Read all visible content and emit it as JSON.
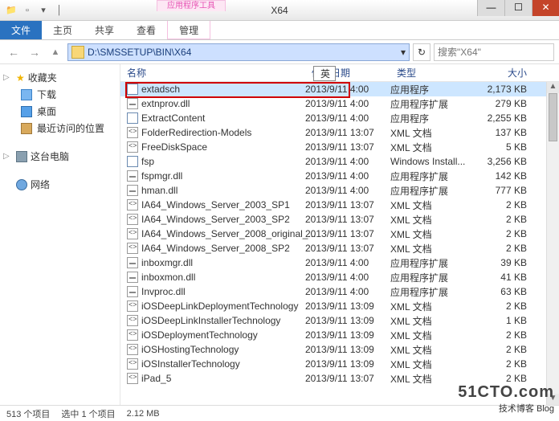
{
  "window": {
    "title": "X64",
    "tool_tab_label": "应用程序工具",
    "tool_tab_below": "管理",
    "min": "—",
    "max": "☐",
    "close": "✕"
  },
  "menubar": {
    "file": "文件",
    "tabs": [
      "主页",
      "共享",
      "查看"
    ]
  },
  "nav": {
    "back": "←",
    "fwd": "→",
    "up": "▲",
    "path": "D:\\SMSSETUP\\BIN\\X64",
    "dropdown": "▾",
    "refresh": "↻",
    "search_placeholder": "搜索\"X64\""
  },
  "sidebar": {
    "fav_header": "收藏夹",
    "fav_items": [
      "下载",
      "桌面",
      "最近访问的位置"
    ],
    "thispc": "这台电脑",
    "network": "网络"
  },
  "columns": {
    "name": "名称",
    "date": "修改日期",
    "type": "类型",
    "size": "大小"
  },
  "ime_badge": "英",
  "files": [
    {
      "name": "extadsch",
      "date": "2013/9/11 4:00",
      "type": "应用程序",
      "size": "2,173 KB",
      "ico": "exe",
      "selected": true
    },
    {
      "name": "extnprov.dll",
      "date": "2013/9/11 4:00",
      "type": "应用程序扩展",
      "size": "279 KB",
      "ico": "dll"
    },
    {
      "name": "ExtractContent",
      "date": "2013/9/11 4:00",
      "type": "应用程序",
      "size": "2,255 KB",
      "ico": "exe"
    },
    {
      "name": "FolderRedirection-Models",
      "date": "2013/9/11 13:07",
      "type": "XML 文档",
      "size": "137 KB",
      "ico": "xml"
    },
    {
      "name": "FreeDiskSpace",
      "date": "2013/9/11 13:07",
      "type": "XML 文档",
      "size": "5 KB",
      "ico": "xml"
    },
    {
      "name": "fsp",
      "date": "2013/9/11 4:00",
      "type": "Windows Install...",
      "size": "3,256 KB",
      "ico": "exe"
    },
    {
      "name": "fspmgr.dll",
      "date": "2013/9/11 4:00",
      "type": "应用程序扩展",
      "size": "142 KB",
      "ico": "dll"
    },
    {
      "name": "hman.dll",
      "date": "2013/9/11 4:00",
      "type": "应用程序扩展",
      "size": "777 KB",
      "ico": "dll"
    },
    {
      "name": "IA64_Windows_Server_2003_SP1",
      "date": "2013/9/11 13:07",
      "type": "XML 文档",
      "size": "2 KB",
      "ico": "xml"
    },
    {
      "name": "IA64_Windows_Server_2003_SP2",
      "date": "2013/9/11 13:07",
      "type": "XML 文档",
      "size": "2 KB",
      "ico": "xml"
    },
    {
      "name": "IA64_Windows_Server_2008_original_...",
      "date": "2013/9/11 13:07",
      "type": "XML 文档",
      "size": "2 KB",
      "ico": "xml"
    },
    {
      "name": "IA64_Windows_Server_2008_SP2",
      "date": "2013/9/11 13:07",
      "type": "XML 文档",
      "size": "2 KB",
      "ico": "xml"
    },
    {
      "name": "inboxmgr.dll",
      "date": "2013/9/11 4:00",
      "type": "应用程序扩展",
      "size": "39 KB",
      "ico": "dll"
    },
    {
      "name": "inboxmon.dll",
      "date": "2013/9/11 4:00",
      "type": "应用程序扩展",
      "size": "41 KB",
      "ico": "dll"
    },
    {
      "name": "Invproc.dll",
      "date": "2013/9/11 4:00",
      "type": "应用程序扩展",
      "size": "63 KB",
      "ico": "dll"
    },
    {
      "name": "iOSDeepLinkDeploymentTechnology",
      "date": "2013/9/11 13:09",
      "type": "XML 文档",
      "size": "2 KB",
      "ico": "xml"
    },
    {
      "name": "iOSDeepLinkInstallerTechnology",
      "date": "2013/9/11 13:09",
      "type": "XML 文档",
      "size": "1 KB",
      "ico": "xml"
    },
    {
      "name": "iOSDeploymentTechnology",
      "date": "2013/9/11 13:09",
      "type": "XML 文档",
      "size": "2 KB",
      "ico": "xml"
    },
    {
      "name": "iOSHostingTechnology",
      "date": "2013/9/11 13:09",
      "type": "XML 文档",
      "size": "2 KB",
      "ico": "xml"
    },
    {
      "name": "iOSInstallerTechnology",
      "date": "2013/9/11 13:09",
      "type": "XML 文档",
      "size": "2 KB",
      "ico": "xml"
    },
    {
      "name": "iPad_5",
      "date": "2013/9/11 13:07",
      "type": "XML 文档",
      "size": "2 KB",
      "ico": "xml"
    }
  ],
  "status": {
    "count": "513 个项目",
    "selected": "选中 1 个项目",
    "size": "2.12 MB"
  },
  "watermark": {
    "brand": "51CTO.com",
    "sub": "技术博客   Blog"
  }
}
